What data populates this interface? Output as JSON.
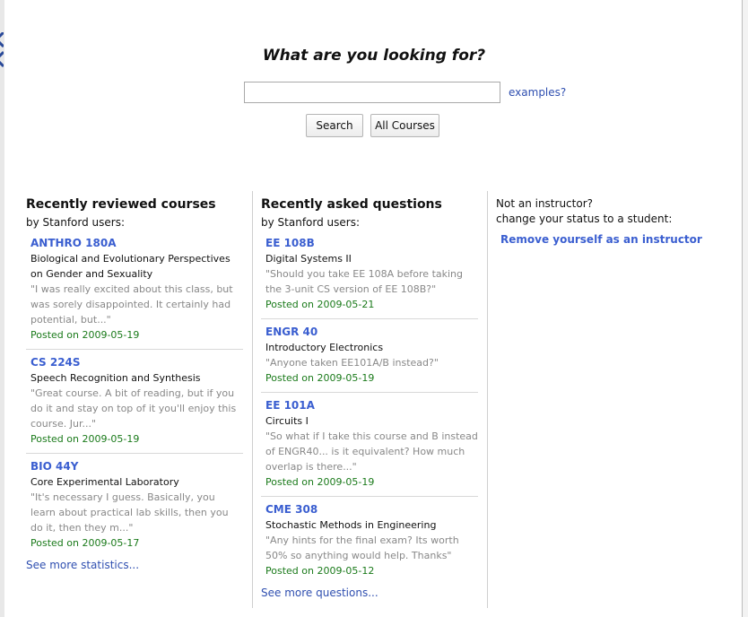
{
  "search": {
    "title": "What are you looking for?",
    "input_value": "",
    "examples_label": "examples?",
    "search_button": "Search",
    "all_courses_button": "All Courses"
  },
  "reviewed": {
    "title": "Recently reviewed courses",
    "subtitle": "by Stanford users:",
    "items": [
      {
        "code": "ANTHRO 180A",
        "name": "Biological and Evolutionary Perspectives on Gender and Sexuality",
        "quote": "\"I was really excited about this class, but was sorely disappointed. It certainly had potential, but...\"",
        "date": "Posted on 2009-05-19"
      },
      {
        "code": "CS 224S",
        "name": "Speech Recognition and Synthesis",
        "quote": "\"Great course. A bit of reading, but if you do it and stay on top of it you'll enjoy this course. Jur...\"",
        "date": "Posted on 2009-05-19"
      },
      {
        "code": "BIO 44Y",
        "name": "Core Experimental Laboratory",
        "quote": "\"It's necessary I guess. Basically, you learn about practical lab skills, then you do it, then they m...\"",
        "date": "Posted on 2009-05-17"
      }
    ],
    "more_label": "See more statistics..."
  },
  "questions": {
    "title": "Recently asked questions",
    "subtitle": "by Stanford users:",
    "items": [
      {
        "code": "EE 108B",
        "name": "Digital Systems II",
        "quote": "\"Should you take EE 108A before taking the 3-unit CS version of EE 108B?\"",
        "date": "Posted on 2009-05-21"
      },
      {
        "code": "ENGR 40",
        "name": "Introductory Electronics",
        "quote": "\"Anyone taken EE101A/B instead?\"",
        "date": "Posted on 2009-05-19"
      },
      {
        "code": "EE 101A",
        "name": "Circuits I",
        "quote": "\"So what if I take this course and B instead of ENGR40... is it equivalent? How much overlap is there...\"",
        "date": "Posted on 2009-05-19"
      },
      {
        "code": "CME 308",
        "name": "Stochastic Methods in Engineering",
        "quote": "\"Any hints for the final exam? Its worth 50% so anything would help. Thanks\"",
        "date": "Posted on 2009-05-12"
      }
    ],
    "more_label": "See more questions..."
  },
  "instructor": {
    "line1": "Not an instructor?",
    "line2": "change your status to a student:",
    "remove_label": "Remove yourself as an instructor"
  }
}
